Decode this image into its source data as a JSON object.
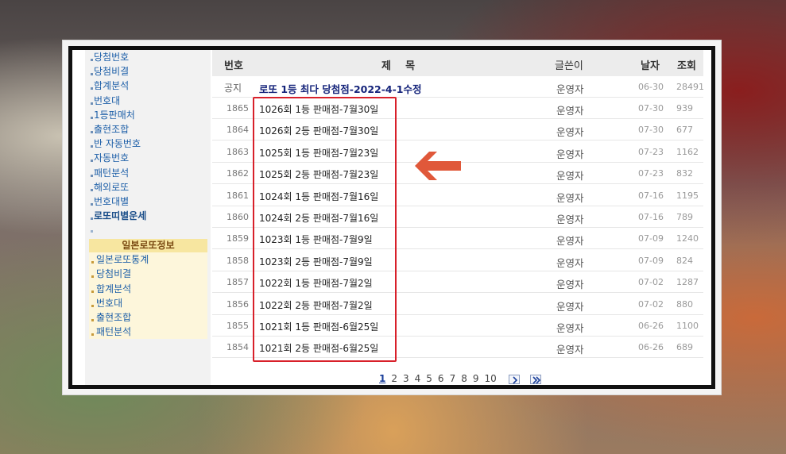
{
  "sidebar": {
    "items": [
      {
        "label": "당첨번호",
        "bold": false
      },
      {
        "label": "당첨비결",
        "bold": false
      },
      {
        "label": "합계분석",
        "bold": false
      },
      {
        "label": "번호대",
        "bold": false
      },
      {
        "label": "1등판매처",
        "bold": false
      },
      {
        "label": "출현조합",
        "bold": false
      },
      {
        "label": "반 자동번호",
        "bold": false
      },
      {
        "label": "자동번호",
        "bold": false
      },
      {
        "label": "패턴분석",
        "bold": false
      },
      {
        "label": "해외로또",
        "bold": false
      },
      {
        "label": "번호대별",
        "bold": false
      },
      {
        "label": "로또띠별운세",
        "bold": true
      }
    ],
    "japan_header": "일본로또정보",
    "japan_items": [
      "일본로또통계",
      "당첨비결",
      "합계분석",
      "번호대",
      "출현조합",
      "패턴분석"
    ]
  },
  "board": {
    "columns": {
      "num": "번호",
      "title": "제    목",
      "author": "글쓴이",
      "date": "날자",
      "views": "조회"
    },
    "notice": {
      "num": "공지",
      "title": "로또 1등 최다 당첨점-2022-4-1수정",
      "author": "운영자",
      "date": "06-30",
      "views": "28491"
    },
    "rows": [
      {
        "num": "1865",
        "title": "1026회 1등 판매점-7월30일",
        "author": "운영자",
        "date": "07-30",
        "views": "939"
      },
      {
        "num": "1864",
        "title": "1026회 2등 판매점-7월30일",
        "author": "운영자",
        "date": "07-30",
        "views": "677"
      },
      {
        "num": "1863",
        "title": "1025회 1등 판매점-7월23일",
        "author": "운영자",
        "date": "07-23",
        "views": "1162"
      },
      {
        "num": "1862",
        "title": "1025회 2등 판매점-7월23일",
        "author": "운영자",
        "date": "07-23",
        "views": "832"
      },
      {
        "num": "1861",
        "title": "1024회 1등 판매점-7월16일",
        "author": "운영자",
        "date": "07-16",
        "views": "1195"
      },
      {
        "num": "1860",
        "title": "1024회 2등 판매점-7월16일",
        "author": "운영자",
        "date": "07-16",
        "views": "789"
      },
      {
        "num": "1859",
        "title": "1023회 1등 판매점-7월9일",
        "author": "운영자",
        "date": "07-09",
        "views": "1240"
      },
      {
        "num": "1858",
        "title": "1023회 2등 판매점-7월9일",
        "author": "운영자",
        "date": "07-09",
        "views": "824"
      },
      {
        "num": "1857",
        "title": "1022회 1등 판매점-7월2일",
        "author": "운영자",
        "date": "07-02",
        "views": "1287"
      },
      {
        "num": "1856",
        "title": "1022회 2등 판매점-7월2일",
        "author": "운영자",
        "date": "07-02",
        "views": "880"
      },
      {
        "num": "1855",
        "title": "1021회 1등 판매점-6월25일",
        "author": "운영자",
        "date": "06-26",
        "views": "1100"
      },
      {
        "num": "1854",
        "title": "1021회 2등 판매점-6월25일",
        "author": "운영자",
        "date": "06-26",
        "views": "689"
      }
    ]
  },
  "pagination": {
    "pages": [
      "1",
      "2",
      "3",
      "4",
      "5",
      "6",
      "7",
      "8",
      "9",
      "10"
    ],
    "current": "1",
    "next_icon": "chevron-right-icon",
    "last_icon": "double-chevron-right-icon"
  },
  "annotation": {
    "highlight_color": "#d8202a",
    "arrow_color": "#e0583a",
    "arrow_icon": "arrow-left-icon"
  }
}
